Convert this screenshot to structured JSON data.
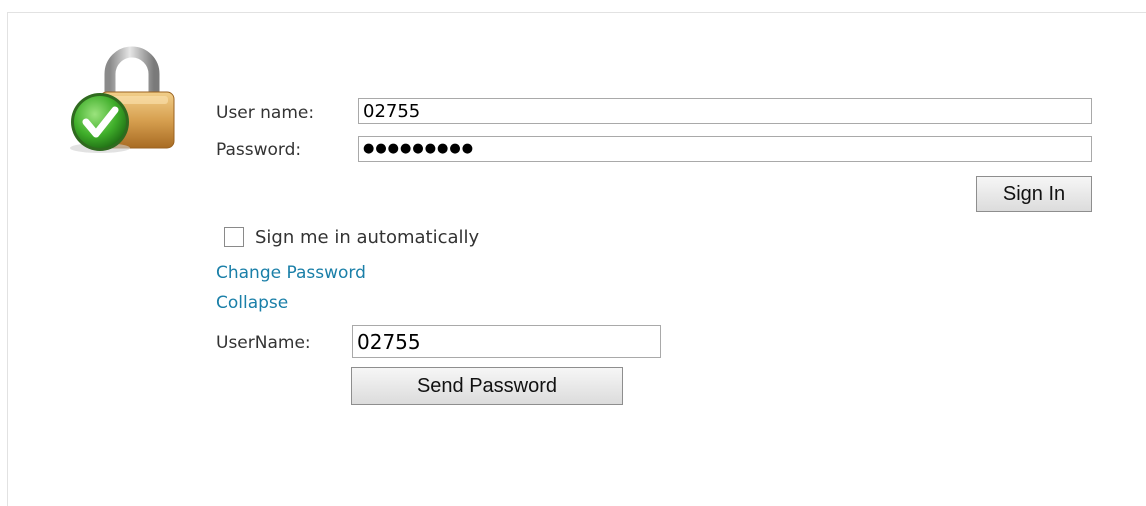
{
  "login": {
    "username_label": "User name:",
    "username_value": "02755",
    "password_label": "Password:",
    "password_masked": "●●●●●●●●●",
    "sign_in_label": "Sign In",
    "remember_label": "Sign me in automatically",
    "remember_checked": false
  },
  "links": {
    "change_password": "Change Password",
    "collapse": "Collapse"
  },
  "recovery": {
    "username_label": "UserName:",
    "username_value": "02755",
    "send_password_label": "Send Password"
  },
  "icons": {
    "lock": "padlock-check-icon"
  },
  "colors": {
    "link": "#1a7fa8",
    "check_green": "#3fae2a"
  }
}
